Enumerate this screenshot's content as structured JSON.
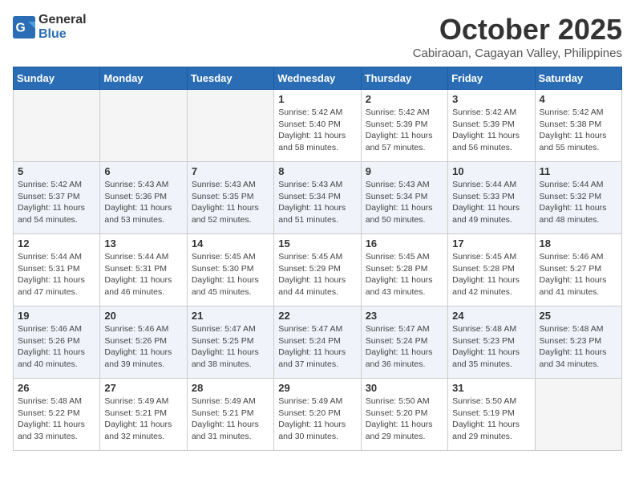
{
  "header": {
    "logo_general": "General",
    "logo_blue": "Blue",
    "month": "October 2025",
    "location": "Cabiraoan, Cagayan Valley, Philippines"
  },
  "days_of_week": [
    "Sunday",
    "Monday",
    "Tuesday",
    "Wednesday",
    "Thursday",
    "Friday",
    "Saturday"
  ],
  "weeks": [
    [
      {
        "day": "",
        "info": ""
      },
      {
        "day": "",
        "info": ""
      },
      {
        "day": "",
        "info": ""
      },
      {
        "day": "1",
        "info": "Sunrise: 5:42 AM\nSunset: 5:40 PM\nDaylight: 11 hours\nand 58 minutes."
      },
      {
        "day": "2",
        "info": "Sunrise: 5:42 AM\nSunset: 5:39 PM\nDaylight: 11 hours\nand 57 minutes."
      },
      {
        "day": "3",
        "info": "Sunrise: 5:42 AM\nSunset: 5:39 PM\nDaylight: 11 hours\nand 56 minutes."
      },
      {
        "day": "4",
        "info": "Sunrise: 5:42 AM\nSunset: 5:38 PM\nDaylight: 11 hours\nand 55 minutes."
      }
    ],
    [
      {
        "day": "5",
        "info": "Sunrise: 5:42 AM\nSunset: 5:37 PM\nDaylight: 11 hours\nand 54 minutes."
      },
      {
        "day": "6",
        "info": "Sunrise: 5:43 AM\nSunset: 5:36 PM\nDaylight: 11 hours\nand 53 minutes."
      },
      {
        "day": "7",
        "info": "Sunrise: 5:43 AM\nSunset: 5:35 PM\nDaylight: 11 hours\nand 52 minutes."
      },
      {
        "day": "8",
        "info": "Sunrise: 5:43 AM\nSunset: 5:34 PM\nDaylight: 11 hours\nand 51 minutes."
      },
      {
        "day": "9",
        "info": "Sunrise: 5:43 AM\nSunset: 5:34 PM\nDaylight: 11 hours\nand 50 minutes."
      },
      {
        "day": "10",
        "info": "Sunrise: 5:44 AM\nSunset: 5:33 PM\nDaylight: 11 hours\nand 49 minutes."
      },
      {
        "day": "11",
        "info": "Sunrise: 5:44 AM\nSunset: 5:32 PM\nDaylight: 11 hours\nand 48 minutes."
      }
    ],
    [
      {
        "day": "12",
        "info": "Sunrise: 5:44 AM\nSunset: 5:31 PM\nDaylight: 11 hours\nand 47 minutes."
      },
      {
        "day": "13",
        "info": "Sunrise: 5:44 AM\nSunset: 5:31 PM\nDaylight: 11 hours\nand 46 minutes."
      },
      {
        "day": "14",
        "info": "Sunrise: 5:45 AM\nSunset: 5:30 PM\nDaylight: 11 hours\nand 45 minutes."
      },
      {
        "day": "15",
        "info": "Sunrise: 5:45 AM\nSunset: 5:29 PM\nDaylight: 11 hours\nand 44 minutes."
      },
      {
        "day": "16",
        "info": "Sunrise: 5:45 AM\nSunset: 5:28 PM\nDaylight: 11 hours\nand 43 minutes."
      },
      {
        "day": "17",
        "info": "Sunrise: 5:45 AM\nSunset: 5:28 PM\nDaylight: 11 hours\nand 42 minutes."
      },
      {
        "day": "18",
        "info": "Sunrise: 5:46 AM\nSunset: 5:27 PM\nDaylight: 11 hours\nand 41 minutes."
      }
    ],
    [
      {
        "day": "19",
        "info": "Sunrise: 5:46 AM\nSunset: 5:26 PM\nDaylight: 11 hours\nand 40 minutes."
      },
      {
        "day": "20",
        "info": "Sunrise: 5:46 AM\nSunset: 5:26 PM\nDaylight: 11 hours\nand 39 minutes."
      },
      {
        "day": "21",
        "info": "Sunrise: 5:47 AM\nSunset: 5:25 PM\nDaylight: 11 hours\nand 38 minutes."
      },
      {
        "day": "22",
        "info": "Sunrise: 5:47 AM\nSunset: 5:24 PM\nDaylight: 11 hours\nand 37 minutes."
      },
      {
        "day": "23",
        "info": "Sunrise: 5:47 AM\nSunset: 5:24 PM\nDaylight: 11 hours\nand 36 minutes."
      },
      {
        "day": "24",
        "info": "Sunrise: 5:48 AM\nSunset: 5:23 PM\nDaylight: 11 hours\nand 35 minutes."
      },
      {
        "day": "25",
        "info": "Sunrise: 5:48 AM\nSunset: 5:23 PM\nDaylight: 11 hours\nand 34 minutes."
      }
    ],
    [
      {
        "day": "26",
        "info": "Sunrise: 5:48 AM\nSunset: 5:22 PM\nDaylight: 11 hours\nand 33 minutes."
      },
      {
        "day": "27",
        "info": "Sunrise: 5:49 AM\nSunset: 5:21 PM\nDaylight: 11 hours\nand 32 minutes."
      },
      {
        "day": "28",
        "info": "Sunrise: 5:49 AM\nSunset: 5:21 PM\nDaylight: 11 hours\nand 31 minutes."
      },
      {
        "day": "29",
        "info": "Sunrise: 5:49 AM\nSunset: 5:20 PM\nDaylight: 11 hours\nand 30 minutes."
      },
      {
        "day": "30",
        "info": "Sunrise: 5:50 AM\nSunset: 5:20 PM\nDaylight: 11 hours\nand 29 minutes."
      },
      {
        "day": "31",
        "info": "Sunrise: 5:50 AM\nSunset: 5:19 PM\nDaylight: 11 hours\nand 29 minutes."
      },
      {
        "day": "",
        "info": ""
      }
    ]
  ]
}
